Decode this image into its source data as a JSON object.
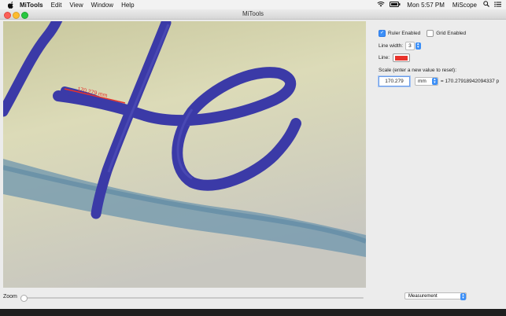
{
  "menubar": {
    "app_name": "MiTools",
    "menus": [
      "Edit",
      "View",
      "Window",
      "Help"
    ],
    "clock": "Mon 5:57 PM",
    "status_app": "MiScope"
  },
  "window": {
    "title": "MiTools",
    "measurement_label": "170.279 mm"
  },
  "panel": {
    "ruler_label": "Ruler Enabled",
    "ruler_checked": true,
    "grid_label": "Grid Enabled",
    "grid_checked": false,
    "line_width_label": "Line width:",
    "line_width_value": "3",
    "line_label": "Line:",
    "line_color": "#e8332b",
    "scale_label": "Scale (enter a new value to reset):",
    "scale_value": "170.279",
    "unit_value": "mm",
    "scale_result": "= 170.27918942094337 p"
  },
  "bottom": {
    "zoom_label": "Zoom",
    "zoom_level": 0,
    "mode_value": "Measurement"
  },
  "colors": {
    "accent": "#3c8ff7",
    "ink": "#3b3aa7",
    "line": "#e8332b"
  }
}
